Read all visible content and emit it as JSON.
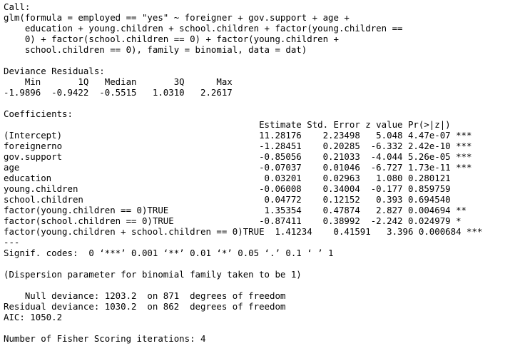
{
  "console": {
    "call": {
      "header": "Call:",
      "formula_lines": [
        "glm(formula = employed == \"yes\" ~ foreigner + gov.support + age +",
        "    education + young.children + school.children + factor(young.children ==",
        "    0) + factor(school.children == 0) + factor(young.children +",
        "    school.children == 0), family = binomial, data = dat)"
      ]
    },
    "deviance_residuals": {
      "header": "Deviance Residuals:",
      "labels_line": "    Min       1Q   Median       3Q      Max  ",
      "values_line": "-1.9896  -0.9422  -0.5515   1.0310   2.2617  "
    },
    "coefficients": {
      "header": "Coefficients:",
      "column_header_line": "                                                Estimate Std. Error z value Pr(>|z|)    ",
      "rows": [
        "(Intercept)                                     11.28176    2.23498   5.048 4.47e-07 ***",
        "foreignerno                                     -1.28451    0.20285  -6.332 2.42e-10 ***",
        "gov.support                                     -0.85056    0.21033  -4.044 5.26e-05 ***",
        "age                                             -0.07037    0.01046  -6.727 1.73e-11 ***",
        "education                                        0.03201    0.02963   1.080 0.280121    ",
        "young.children                                  -0.06008    0.34004  -0.177 0.859759    ",
        "school.children                                  0.04772    0.12152   0.393 0.694540    ",
        "factor(young.children == 0)TRUE                  1.35354    0.47874   2.827 0.004694 ** ",
        "factor(school.children == 0)TRUE                -0.87411    0.38992  -2.242 0.024979 *  ",
        "factor(young.children + school.children == 0)TRUE  1.41234    0.41591   3.396 0.000684 ***"
      ],
      "separator": "---",
      "signif_codes": "Signif. codes:  0 ‘***’ 0.001 ‘**’ 0.01 ‘*’ 0.05 ‘.’ 0.1 ‘ ’ 1"
    },
    "dispersion_note": "(Dispersion parameter for binomial family taken to be 1)",
    "deviance": {
      "null_line": "    Null deviance: 1203.2  on 871  degrees of freedom",
      "residual_line": "Residual deviance: 1030.2  on 862  degrees of freedom",
      "aic_line": "AIC: 1050.2"
    },
    "fisher_iterations": "Number of Fisher Scoring iterations: 4"
  }
}
